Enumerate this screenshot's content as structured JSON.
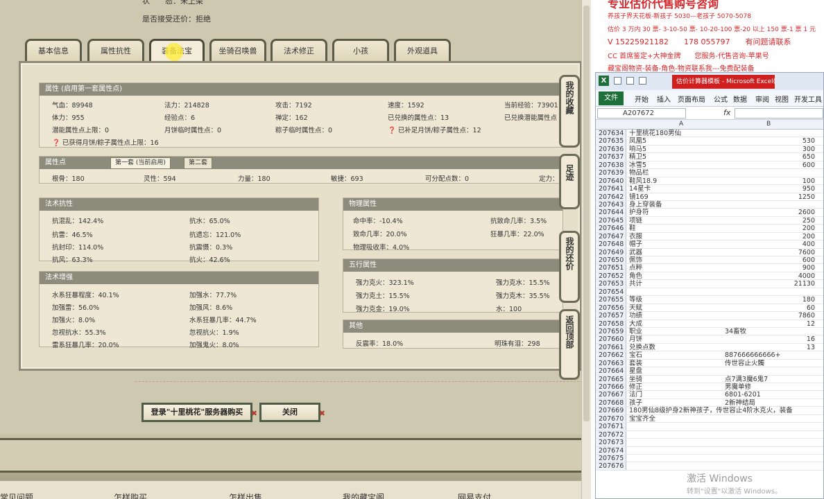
{
  "game": {
    "top_info": [
      {
        "label": "状　　态：",
        "value": "未上架"
      },
      {
        "label": "是否接受还价：",
        "value": "拒绝"
      }
    ],
    "tabs": [
      "基本信息",
      "属性抗性",
      "装备法宝",
      "坐骑召唤兽",
      "法术修正",
      "小孩",
      "外观道具"
    ],
    "active_tab": "装备法宝",
    "attr_section": {
      "title": "属性 (启用第一套属性点)",
      "items": [
        "气血：89948",
        "法力：214828",
        "攻击：7192",
        "速度：1592",
        "当前经验：73901",
        "体力：955",
        "经验点：6",
        "禅定：162",
        "已兑换的属性点：13",
        "已兑换潜能属性点",
        "潜能属性点上限：0",
        "月饼临时属性点：0",
        "粽子临时属性点：0",
        "已补足月饼/粽子属性点：12",
        "已获得月饼/粽子属性点上限：16"
      ]
    },
    "points_section": {
      "title": "属性点",
      "subtabs": [
        "第一套 (当前启用)",
        "第二套"
      ],
      "items": [
        "根骨：180",
        "灵性：594",
        "力量：180",
        "敏捷：693",
        "可分配点数：0",
        "定力："
      ]
    },
    "resist_section": {
      "title": "法术抗性",
      "items": [
        "抗混乱：142.4%",
        "抗水：65.0%",
        "抗雷：46.5%",
        "抗遗忘：121.0%",
        "抗封印：114.0%",
        "抗震慑：0.3%",
        "抗风：63.3%",
        "抗火：42.6%"
      ]
    },
    "boost_section": {
      "title": "法术增强",
      "items": [
        "水系狂暴程度：40.1%",
        "加强水：77.7%",
        "加强雷：56.0%",
        "加强风：8.6%",
        "加强火：8.0%",
        "水系狂暴几率：44.7%",
        "忽视抗水：55.3%",
        "忽视抗火：1.9%",
        "雷系狂暴几率：20.0%",
        "加强鬼火：8.0%"
      ]
    },
    "phys_section": {
      "title": "物理属性",
      "items": [
        "命中率：-10.4%",
        "抗致命几率：3.5%",
        "致命几率：20.0%",
        "狂暴几率：22.0%",
        "物理吸收率：4.0%"
      ]
    },
    "wuxing_section": {
      "title": "五行属性",
      "items": [
        "强力克火：323.1%",
        "强力克水：15.5%",
        "强力克土：15.5%",
        "强力克木：35.5%",
        "强力克金：19.0%",
        "水：100"
      ]
    },
    "other_section": {
      "title": "其他",
      "items": [
        "反震率：18.0%",
        "明珠有泪：298"
      ]
    },
    "side_buttons": [
      "我的收藏",
      "足迹",
      "我的还价",
      "返回顶部"
    ],
    "buy_button": "登录\"十里桃花\"服务器购买",
    "close_button": "关闭",
    "footer_nav": [
      "常见问题",
      "怎样购买",
      "怎样出售",
      "我的藏宝阁",
      "网易支付"
    ]
  },
  "promo": {
    "lines": [
      "专业估价代售购号咨询",
      "养孩子界天花板-新孩子 5030—老孩子 5070-5078",
      "估价 3 万内 30 票- 3-10-50 票- 10-20-100 票-20 以上 150 票-1 票 1 元",
      "V 15225921182　　178 055797　　有问题请联系",
      "CC 首席鉴定+大神金牌　　您服务-代售咨询-苹果号",
      "藏宝阁物资-装备-角色-物资联系我---免费配装备"
    ]
  },
  "excel": {
    "title": "估价计算器模板 - Microsoft Excel(产品...",
    "ribbon_tabs": [
      "文件",
      "开始",
      "插入",
      "页面布局",
      "公式",
      "数据",
      "审阅",
      "视图",
      "开发工具"
    ],
    "name_box": "A207672",
    "fx": "fx",
    "col_a": "A",
    "col_b": "B",
    "rows": [
      {
        "n": "207634",
        "a": "十里桃花180男仙",
        "b": "",
        "num": ""
      },
      {
        "n": "207635",
        "a": "凤凰5",
        "b": "",
        "num": "530"
      },
      {
        "n": "207636",
        "a": "响马5",
        "b": "",
        "num": "300"
      },
      {
        "n": "207637",
        "a": "精卫5",
        "b": "",
        "num": "650"
      },
      {
        "n": "207638",
        "a": "冰雪5",
        "b": "",
        "num": "600"
      },
      {
        "n": "207639",
        "a": "物品栏",
        "b": "",
        "num": ""
      },
      {
        "n": "207640",
        "a": "鞋风18.9",
        "b": "",
        "num": "100"
      },
      {
        "n": "207641",
        "a": "14星卡",
        "b": "",
        "num": "950"
      },
      {
        "n": "207642",
        "a": "镜169",
        "b": "",
        "num": "1250"
      },
      {
        "n": "207643",
        "a": "身上穿装备",
        "b": "",
        "num": ""
      },
      {
        "n": "207644",
        "a": "护身符",
        "b": "",
        "num": "2600"
      },
      {
        "n": "207645",
        "a": "项链",
        "b": "",
        "num": "250"
      },
      {
        "n": "207646",
        "a": "鞋",
        "b": "",
        "num": "200"
      },
      {
        "n": "207647",
        "a": "衣服",
        "b": "",
        "num": "200"
      },
      {
        "n": "207648",
        "a": "帽子",
        "b": "",
        "num": "400"
      },
      {
        "n": "207649",
        "a": "武器",
        "b": "",
        "num": "7600"
      },
      {
        "n": "207650",
        "a": "佩饰",
        "b": "",
        "num": "600"
      },
      {
        "n": "207651",
        "a": "点粹",
        "b": "",
        "num": "900"
      },
      {
        "n": "207652",
        "a": "角色",
        "b": "",
        "num": "4000"
      },
      {
        "n": "207653",
        "a": "共计",
        "b": "",
        "num": "21130"
      },
      {
        "n": "207654",
        "a": "",
        "b": "",
        "num": ""
      },
      {
        "n": "207655",
        "a": "等级",
        "b": "",
        "num": "180"
      },
      {
        "n": "207656",
        "a": "天赋",
        "b": "",
        "num": "60"
      },
      {
        "n": "207657",
        "a": "功绩",
        "b": "",
        "num": "7860"
      },
      {
        "n": "207658",
        "a": "大成",
        "b": "",
        "num": "12"
      },
      {
        "n": "207659",
        "a": "职业",
        "b": "34畜牧",
        "num": ""
      },
      {
        "n": "207660",
        "a": "月饼",
        "b": "",
        "num": "16"
      },
      {
        "n": "207661",
        "a": "兑换点数",
        "b": "",
        "num": "13"
      },
      {
        "n": "207662",
        "a": "宝石",
        "b": "887666666666+",
        "num": ""
      },
      {
        "n": "207663",
        "a": "套装",
        "b": "传世容止火髑",
        "num": ""
      },
      {
        "n": "207664",
        "a": "星盘",
        "b": "",
        "num": ""
      },
      {
        "n": "207665",
        "a": "坐骑",
        "b": "点7满3魔6鬼7",
        "num": ""
      },
      {
        "n": "207666",
        "a": "修正",
        "b": "男魔单修",
        "num": ""
      },
      {
        "n": "207667",
        "a": "法门",
        "b": "6801-6201",
        "num": ""
      },
      {
        "n": "207668",
        "a": "孩子",
        "b": "2新神结局",
        "num": ""
      },
      {
        "n": "207669",
        "a": "180男仙8级护身2新神孩子，传世容止4阶水克火，装备",
        "b": "",
        "num": ""
      },
      {
        "n": "207670",
        "a": "宝宝齐全",
        "b": "",
        "num": ""
      },
      {
        "n": "207671",
        "a": "",
        "b": "",
        "num": ""
      },
      {
        "n": "207672",
        "a": "",
        "b": "",
        "num": ""
      },
      {
        "n": "207673",
        "a": "",
        "b": "",
        "num": ""
      },
      {
        "n": "207674",
        "a": "",
        "b": "",
        "num": ""
      },
      {
        "n": "207675",
        "a": "",
        "b": "",
        "num": ""
      },
      {
        "n": "207676",
        "a": "",
        "b": "",
        "num": ""
      }
    ],
    "watermark": "激活 Windows",
    "watermark_sub": "转到\"设置\"以激活 Windows。"
  }
}
